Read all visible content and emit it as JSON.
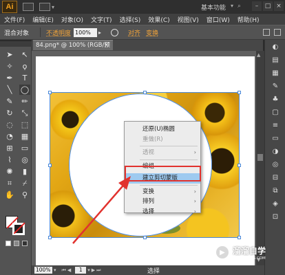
{
  "app": {
    "logo_text": "Ai",
    "workspace": "基本功能",
    "window_controls": [
      "–",
      "□",
      "×"
    ]
  },
  "menubar": [
    "文件(F)",
    "编辑(E)",
    "对象(O)",
    "文字(T)",
    "选择(S)",
    "效果(C)",
    "视图(V)",
    "窗口(W)",
    "帮助(H)"
  ],
  "controlbar": {
    "object_type": "混合对象",
    "opacity_label": "不透明度",
    "opacity_value": "100%",
    "align_label": "对齐",
    "transform_label": "变换"
  },
  "document": {
    "tab_title": "84.png* @ 100% (RGB/预览)",
    "close": "×"
  },
  "context_menu": {
    "items": [
      {
        "label": "还原(U)椭圆",
        "state": "enabled"
      },
      {
        "label": "重做(R)",
        "state": "disabled"
      },
      {
        "label": "透视",
        "state": "disabled",
        "submenu": true
      },
      {
        "label": "编组",
        "state": "enabled"
      },
      {
        "label": "建立剪切蒙版",
        "state": "highlighted"
      },
      {
        "label": "变换",
        "state": "enabled",
        "submenu": true
      },
      {
        "label": "排列",
        "state": "enabled",
        "submenu": true
      },
      {
        "label": "选择",
        "state": "enabled",
        "submenu": true
      }
    ],
    "highlight_color": "#9ecaf0",
    "annotation_color": "#e1322e"
  },
  "statusbar": {
    "zoom": "100%",
    "page": "1",
    "tool": "选择"
  },
  "watermark": {
    "title": "溜溜自学",
    "subtitle": "ZIXUE.3D66.COM"
  },
  "icons": {
    "tools": [
      "selection-tool-icon",
      "direct-selection-tool-icon",
      "magic-wand-icon",
      "lasso-icon",
      "pen-tool-icon",
      "type-tool-icon",
      "line-tool-icon",
      "ellipse-tool-icon",
      "paintbrush-icon",
      "pencil-icon",
      "rotate-tool-icon",
      "scale-tool-icon",
      "warp-tool-icon",
      "free-transform-icon",
      "shape-builder-icon",
      "perspective-grid-icon",
      "mesh-tool-icon",
      "gradient-tool-icon",
      "eyedropper-icon",
      "blend-tool-icon",
      "symbol-sprayer-icon",
      "graph-tool-icon",
      "artboard-tool-icon",
      "slice-tool-icon",
      "hand-tool-icon",
      "zoom-tool-icon"
    ]
  }
}
